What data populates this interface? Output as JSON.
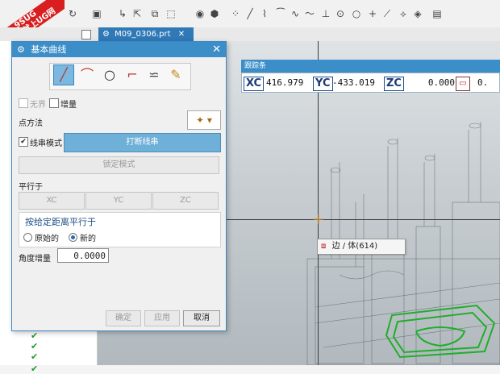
{
  "watermark": {
    "line1": "9SUG",
    "line2": "学UG就上UG网"
  },
  "document_tab": {
    "label": "M09_0306.prt"
  },
  "tracking_bar": {
    "title": "跟踪条",
    "xc_label": "XC",
    "xc_value": "416.979",
    "yc_label": "YC",
    "yc_value": "-433.019",
    "zc_label": "ZC",
    "zc_value": "0.000",
    "extra_value": "0."
  },
  "tooltip": {
    "text": "边 / 体(614)"
  },
  "dialog": {
    "title": "基本曲线",
    "infinite_label": "无界",
    "increment_label": "增量",
    "point_method_label": "点方法",
    "string_mode_label": "线串模式",
    "break_string_button": "打断线串",
    "lock_mode_button": "锁定模式",
    "parallel_to_label": "平行于",
    "xc_button": "XC",
    "yc_button": "YC",
    "zc_button": "ZC",
    "parallel_distance_heading": "按给定距离平行于",
    "original_option": "原始的",
    "new_option": "新的",
    "angle_increment_label": "角度增量",
    "angle_increment_value": "0.0000",
    "ok_button": "确定",
    "apply_button": "应用",
    "cancel_button": "取消"
  },
  "colors": {
    "accent": "#3b8ec8",
    "selection_green": "#1fae2a"
  }
}
